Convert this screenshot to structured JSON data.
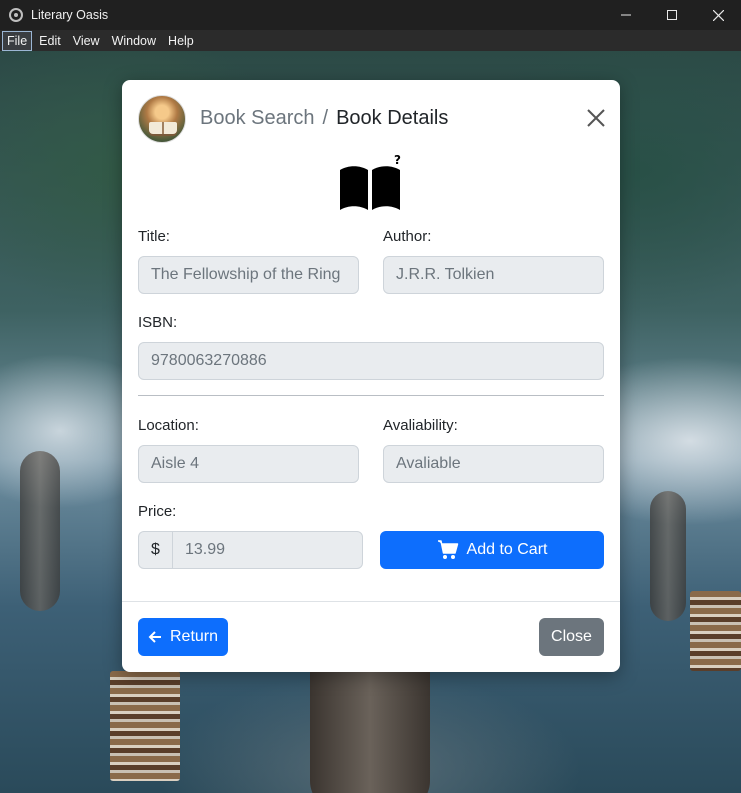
{
  "window": {
    "title": "Literary Oasis",
    "controls": [
      "minimize-icon",
      "maximize-icon",
      "close-icon"
    ]
  },
  "menubar": {
    "items": [
      "File",
      "Edit",
      "View",
      "Window",
      "Help"
    ],
    "active": "File"
  },
  "modal": {
    "breadcrumb": {
      "parent": "Book Search",
      "separator": "/",
      "current": "Book Details"
    },
    "book_icon": "book-unknown-icon",
    "fields": {
      "title": {
        "label": "Title:",
        "value": "The Fellowship of the Ring"
      },
      "author": {
        "label": "Author:",
        "value": "J.R.R. Tolkien"
      },
      "isbn": {
        "label": "ISBN:",
        "value": "9780063270886"
      },
      "location": {
        "label": "Location:",
        "value": "Aisle 4"
      },
      "availability": {
        "label": "Avaliability:",
        "value": "Avaliable"
      },
      "price": {
        "label": "Price:",
        "prefix": "$",
        "value": "13.99"
      }
    },
    "add_to_cart_label": "Add to Cart",
    "return_label": "Return",
    "close_label": "Close",
    "colors": {
      "primary": "#0d6efd",
      "secondary": "#6c757d",
      "input_bg": "#e9ecef"
    }
  }
}
